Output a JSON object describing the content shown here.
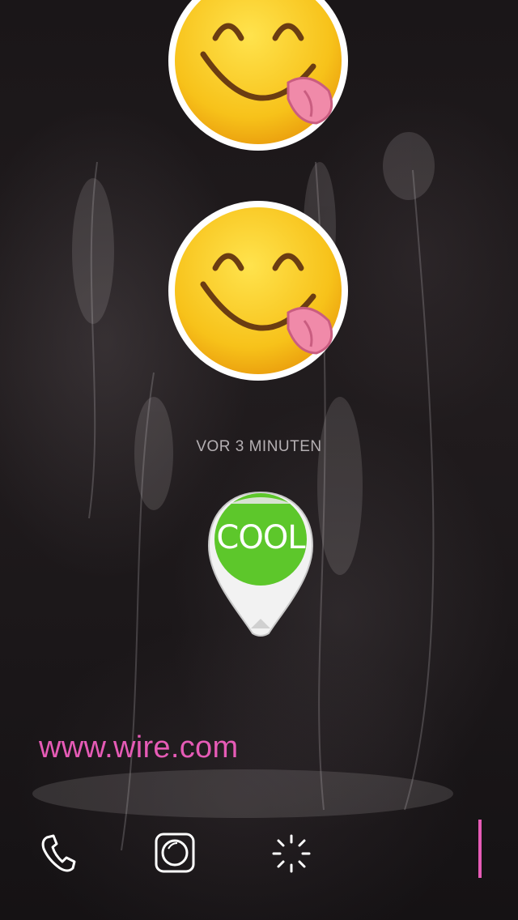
{
  "conversation": {
    "messages": [
      {
        "type": "emoji",
        "icon": "yum-face-emoji"
      },
      {
        "type": "emoji",
        "icon": "yum-face-emoji"
      }
    ],
    "timestamp": "VOR 3 MINUTEN",
    "sticker": {
      "label": "COOL",
      "color": "#5dc72b"
    },
    "link_text": "www.wire.com"
  },
  "toolbar": {
    "icons": [
      "phone-icon",
      "camera-icon",
      "sketch-icon"
    ],
    "accent": "#e65bb6"
  }
}
